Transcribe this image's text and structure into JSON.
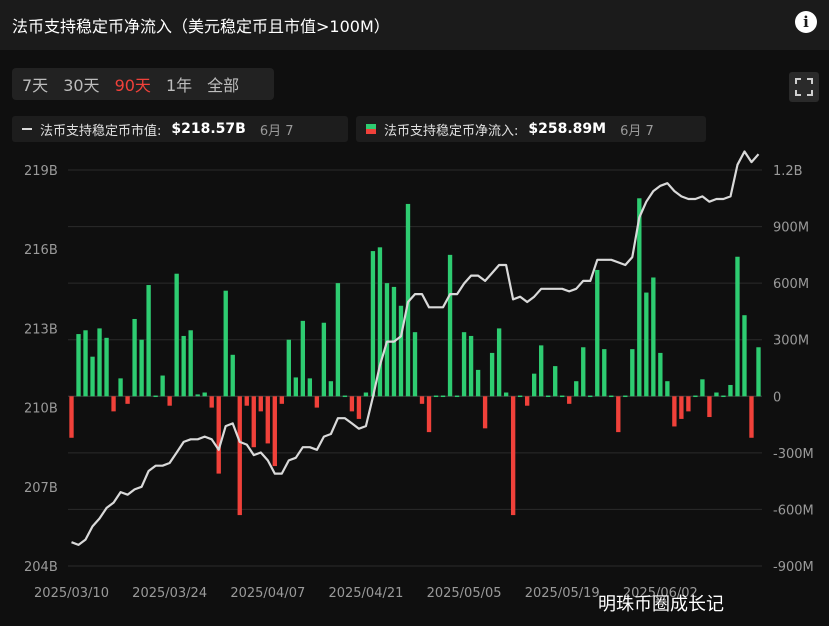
{
  "header": {
    "title": "法币支持稳定币净流入（美元稳定币且市值>100M）"
  },
  "range_buttons": [
    "7天",
    "30天",
    "90天",
    "1年",
    "全部"
  ],
  "active_range": 2,
  "legend": [
    {
      "name": "法币支持稳定币市值:",
      "value": "$218.57B",
      "date": "6月 7"
    },
    {
      "name": "法币支持稳定币净流入:",
      "value": "$258.89M",
      "date": "6月 7"
    }
  ],
  "watermark": "明珠币圈成长记",
  "chart_data": {
    "type": "bar",
    "x_ticks": [
      "2025/03/10",
      "2025/03/24",
      "2025/04/07",
      "2025/04/21",
      "2025/05/05",
      "2025/05/19",
      "2025/06/02"
    ],
    "y_left_ticks": [
      "204B",
      "207B",
      "210B",
      "213B",
      "216B",
      "219B"
    ],
    "y_right_ticks": [
      "-900M",
      "-600M",
      "-300M",
      "0",
      "300M",
      "600M",
      "900M",
      "1.2B"
    ],
    "y_left_lim": [
      204,
      219
    ],
    "y_right_lim": [
      -900,
      1200
    ],
    "colors": {
      "positive": "#2ecc71",
      "negative": "#f0413a",
      "line": "#d9d9d9"
    },
    "series": [
      {
        "name": "法币支持稳定币净流入:",
        "type": "bar",
        "unit": "M",
        "values": [
          -220,
          330,
          350,
          210,
          360,
          310,
          -80,
          95,
          -40,
          410,
          300,
          590,
          0,
          110,
          -50,
          650,
          320,
          350,
          10,
          20,
          -60,
          -410,
          560,
          220,
          -630,
          -50,
          -270,
          -80,
          -250,
          -370,
          -40,
          300,
          100,
          400,
          95,
          -60,
          390,
          80,
          600,
          0,
          -80,
          -120,
          20,
          770,
          790,
          600,
          580,
          480,
          1020,
          340,
          -40,
          -190,
          0,
          0,
          750,
          0,
          340,
          320,
          140,
          -170,
          230,
          360,
          20,
          -630,
          0,
          -50,
          120,
          270,
          0,
          160,
          0,
          -40,
          80,
          260,
          0,
          670,
          250,
          0,
          -190,
          0,
          250,
          1050,
          550,
          630,
          230,
          80,
          -160,
          -120,
          -80,
          0,
          90,
          -110,
          20,
          0,
          60,
          740,
          430,
          -220,
          260
        ]
      },
      {
        "name": "法币支持稳定币市值:",
        "type": "line",
        "unit": "B",
        "values": [
          204.9,
          204.8,
          205.0,
          205.5,
          205.8,
          206.2,
          206.4,
          206.8,
          206.7,
          206.9,
          207.0,
          207.6,
          207.8,
          207.8,
          207.9,
          208.3,
          208.7,
          208.8,
          208.8,
          208.9,
          208.8,
          208.4,
          209.3,
          209.4,
          208.7,
          208.6,
          208.2,
          208.3,
          208.0,
          207.5,
          207.5,
          208.0,
          208.1,
          208.5,
          208.5,
          208.4,
          208.9,
          209.0,
          209.6,
          209.6,
          209.4,
          209.2,
          209.3,
          210.4,
          211.6,
          212.5,
          212.5,
          212.7,
          214.0,
          214.3,
          214.3,
          213.8,
          213.8,
          213.8,
          214.3,
          214.3,
          214.7,
          215.0,
          215.0,
          214.8,
          215.1,
          215.4,
          215.4,
          214.1,
          214.2,
          214.0,
          214.2,
          214.5,
          214.5,
          214.5,
          214.5,
          214.4,
          214.5,
          214.8,
          214.8,
          215.6,
          215.6,
          215.6,
          215.5,
          215.4,
          215.7,
          217.2,
          217.8,
          218.2,
          218.4,
          218.5,
          218.2,
          218.0,
          217.9,
          217.9,
          218.0,
          217.8,
          217.9,
          217.9,
          218.0,
          219.2,
          219.7,
          219.3,
          219.6
        ]
      }
    ]
  }
}
